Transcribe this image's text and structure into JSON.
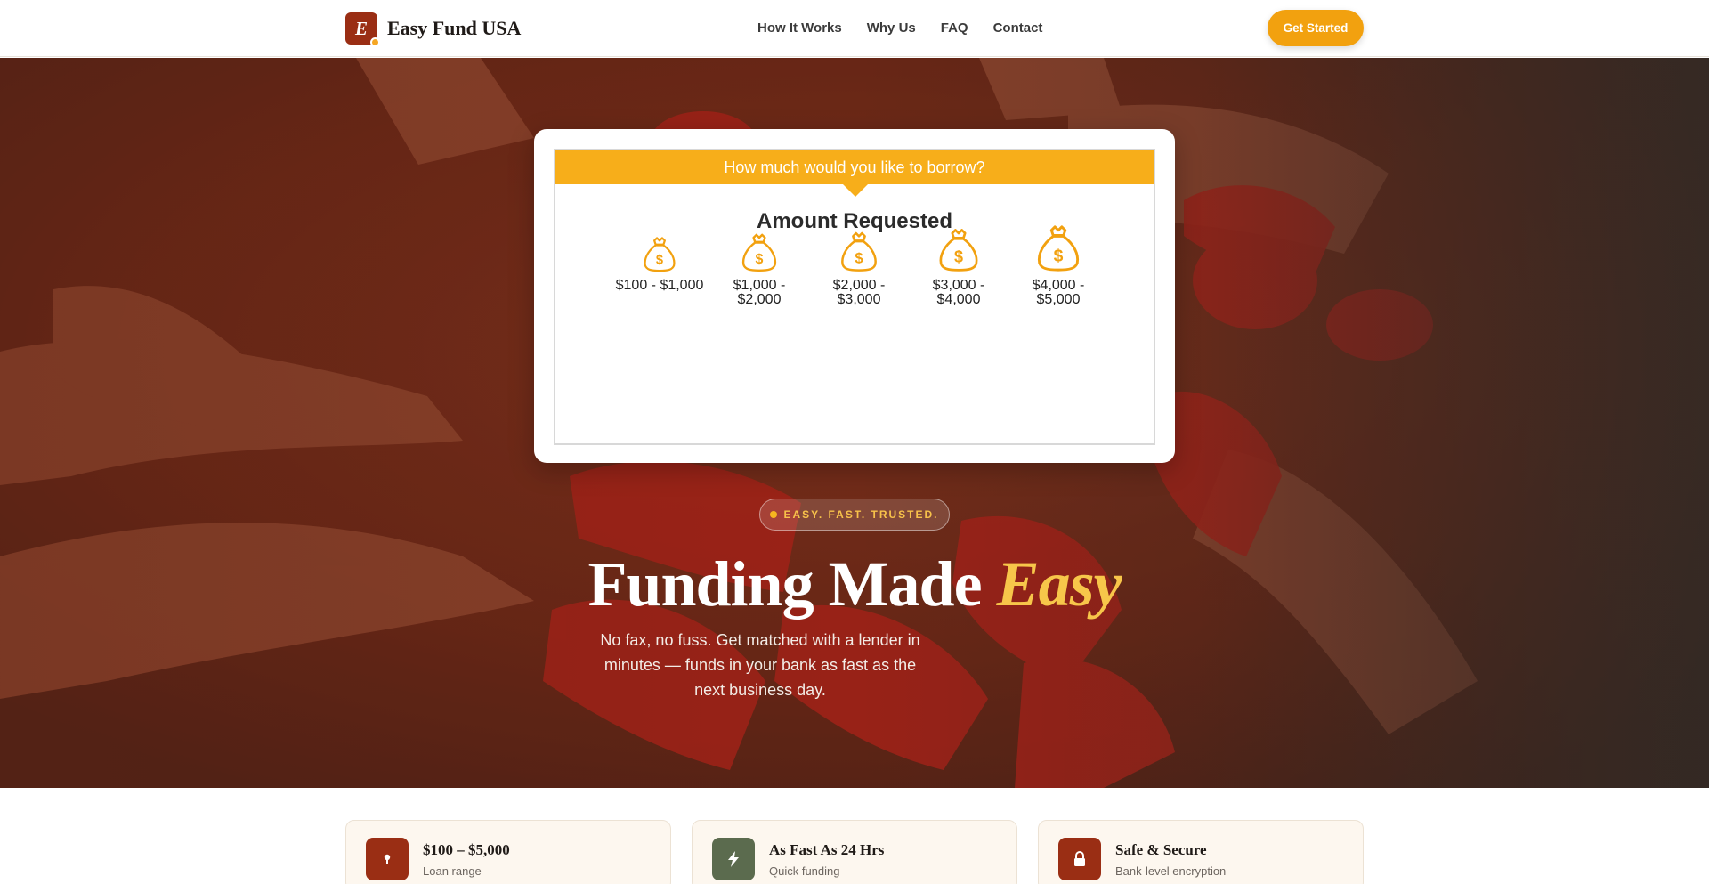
{
  "header": {
    "logo_letter": "E",
    "brand": "Easy Fund USA",
    "nav": [
      "How It Works",
      "Why Us",
      "FAQ",
      "Contact"
    ],
    "cta_label": "Get Started"
  },
  "quiz": {
    "banner": "How much would you like to borrow?",
    "title": "Amount Requested",
    "options": [
      {
        "line1": "$100 - $1,000",
        "line2": ""
      },
      {
        "line1": "$1,000 -",
        "line2": "$2,000"
      },
      {
        "line1": "$2,000 -",
        "line2": "$3,000"
      },
      {
        "line1": "$3,000 -",
        "line2": "$4,000"
      },
      {
        "line1": "$4,000 -",
        "line2": "$5,000"
      }
    ]
  },
  "hero": {
    "pill": "EASY. FAST. TRUSTED.",
    "headline_main": "Funding Made",
    "headline_accent": "Easy",
    "subtext": "No fax, no fuss. Get matched with a lender in minutes — funds in your bank as fast as the next business day."
  },
  "features": [
    {
      "title": "$100 – $5,000",
      "sub": "Loan range",
      "icon": "dollar-icon",
      "color": "#9a2e14"
    },
    {
      "title": "As Fast As 24 Hrs",
      "sub": "Quick funding",
      "icon": "lightning-icon",
      "color": "#5b6b4e"
    },
    {
      "title": "Safe & Secure",
      "sub": "Bank-level encryption",
      "icon": "lock-icon",
      "color": "#9a2e14"
    }
  ],
  "colors": {
    "brand": "#9a2e14",
    "accent": "#f7ae1a",
    "headline_accent": "#f7c64a"
  }
}
